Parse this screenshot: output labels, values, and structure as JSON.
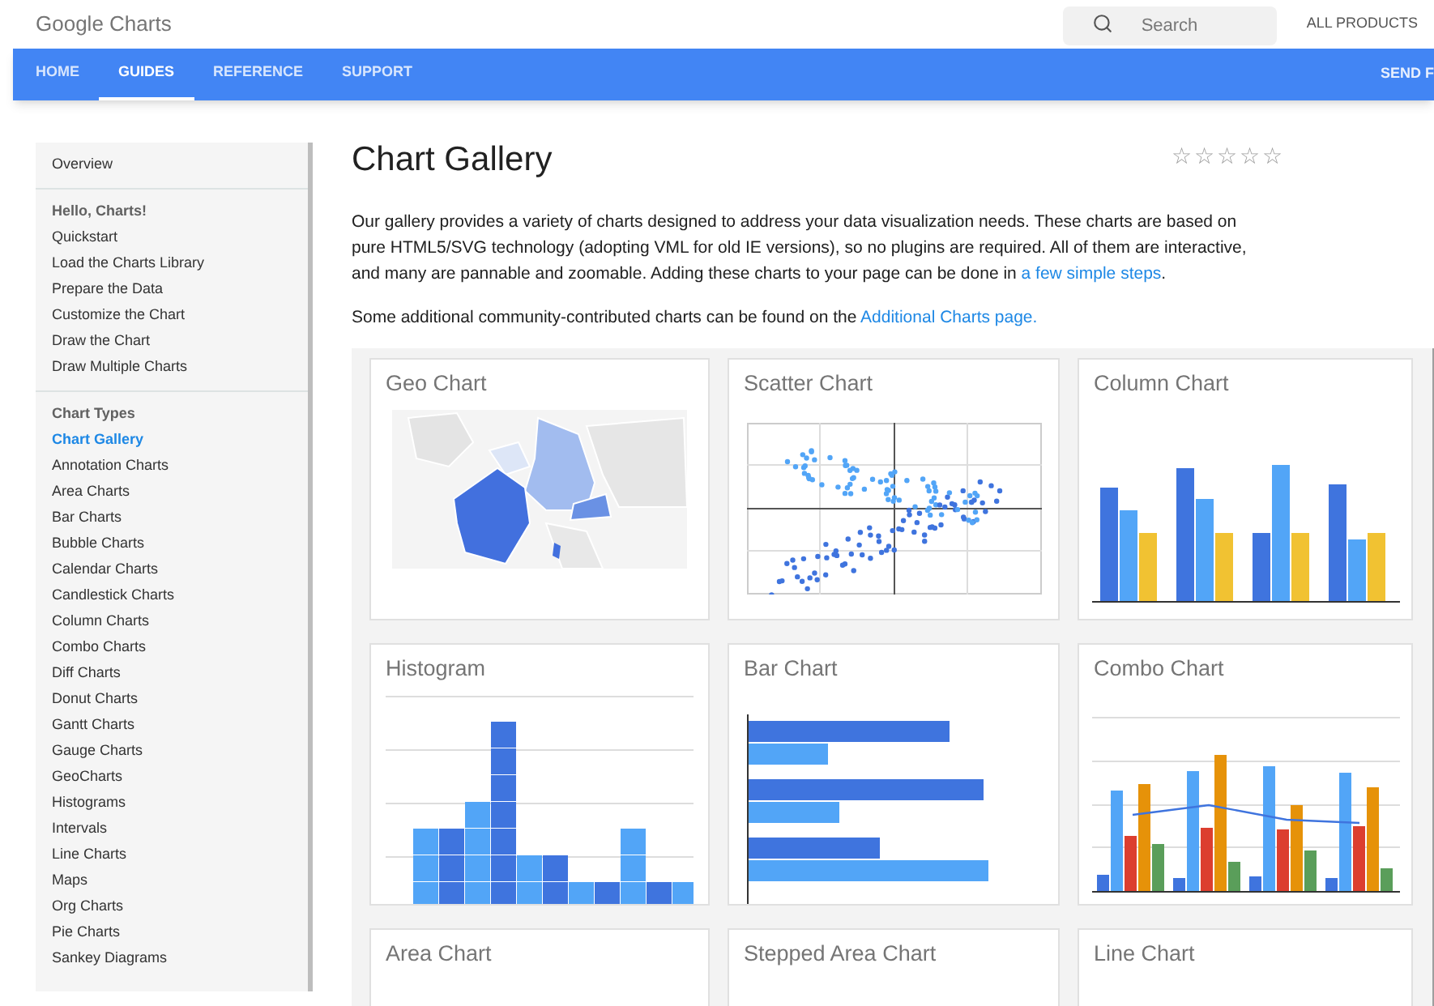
{
  "header": {
    "logo": "Google Charts",
    "search": {
      "placeholder": "Search"
    },
    "all_products": "ALL PRODUCTS"
  },
  "nav": {
    "tabs": [
      {
        "label": "HOME",
        "selected": false
      },
      {
        "label": "GUIDES",
        "selected": true
      },
      {
        "label": "REFERENCE",
        "selected": false
      },
      {
        "label": "SUPPORT",
        "selected": false
      }
    ],
    "send_feedback": "SEND F"
  },
  "sidebar": {
    "sections": [
      {
        "items": [
          {
            "label": "Overview",
            "kind": "link",
            "selected": false
          }
        ]
      },
      {
        "items": [
          {
            "label": "Hello, Charts!",
            "kind": "heading",
            "selected": false
          },
          {
            "label": "Quickstart",
            "kind": "link",
            "selected": false
          },
          {
            "label": "Load the Charts Library",
            "kind": "link",
            "selected": false
          },
          {
            "label": "Prepare the Data",
            "kind": "link",
            "selected": false
          },
          {
            "label": "Customize the Chart",
            "kind": "link",
            "selected": false
          },
          {
            "label": "Draw the Chart",
            "kind": "link",
            "selected": false
          },
          {
            "label": "Draw Multiple Charts",
            "kind": "link",
            "selected": false
          }
        ]
      },
      {
        "items": [
          {
            "label": "Chart Types",
            "kind": "heading",
            "selected": false
          },
          {
            "label": "Chart Gallery",
            "kind": "link",
            "selected": true
          },
          {
            "label": "Annotation Charts",
            "kind": "link",
            "selected": false
          },
          {
            "label": "Area Charts",
            "kind": "link",
            "selected": false
          },
          {
            "label": "Bar Charts",
            "kind": "link",
            "selected": false
          },
          {
            "label": "Bubble Charts",
            "kind": "link",
            "selected": false
          },
          {
            "label": "Calendar Charts",
            "kind": "link",
            "selected": false
          },
          {
            "label": "Candlestick Charts",
            "kind": "link",
            "selected": false
          },
          {
            "label": "Column Charts",
            "kind": "link",
            "selected": false
          },
          {
            "label": "Combo Charts",
            "kind": "link",
            "selected": false
          },
          {
            "label": "Diff Charts",
            "kind": "link",
            "selected": false
          },
          {
            "label": "Donut Charts",
            "kind": "link",
            "selected": false
          },
          {
            "label": "Gantt Charts",
            "kind": "link",
            "selected": false
          },
          {
            "label": "Gauge Charts",
            "kind": "link",
            "selected": false
          },
          {
            "label": "GeoCharts",
            "kind": "link",
            "selected": false
          },
          {
            "label": "Histograms",
            "kind": "link",
            "selected": false
          },
          {
            "label": "Intervals",
            "kind": "link",
            "selected": false
          },
          {
            "label": "Line Charts",
            "kind": "link",
            "selected": false
          },
          {
            "label": "Maps",
            "kind": "link",
            "selected": false
          },
          {
            "label": "Org Charts",
            "kind": "link",
            "selected": false
          },
          {
            "label": "Pie Charts",
            "kind": "link",
            "selected": false
          },
          {
            "label": "Sankey Diagrams",
            "kind": "link",
            "selected": false
          }
        ]
      }
    ]
  },
  "main": {
    "title": "Chart Gallery",
    "rating": {
      "stars": 0
    },
    "intro": "Our gallery provides a variety of charts designed to address your data visualization needs. These charts are based on pure HTML5/SVG technology (adopting VML for old IE versions), so no plugins are required. All of them are interactive, and many are pannable and zoomable. Adding these charts to your page can be done in ",
    "intro_link": "a few simple steps",
    "intro_end": ".",
    "community": "Some additional community-contributed charts can be found on the ",
    "community_link": "Additional Charts page.",
    "gallery": [
      {
        "title": "Geo Chart",
        "kind": "geo"
      },
      {
        "title": "Scatter Chart",
        "kind": "scatter"
      },
      {
        "title": "Column Chart",
        "kind": "column"
      },
      {
        "title": "Histogram",
        "kind": "histogram"
      },
      {
        "title": "Bar Chart",
        "kind": "bar"
      },
      {
        "title": "Combo Chart",
        "kind": "combo"
      },
      {
        "title": "Area Chart",
        "kind": "area"
      },
      {
        "title": "Stepped Area Chart",
        "kind": "stepped_area"
      },
      {
        "title": "Line Chart",
        "kind": "line"
      }
    ]
  }
}
